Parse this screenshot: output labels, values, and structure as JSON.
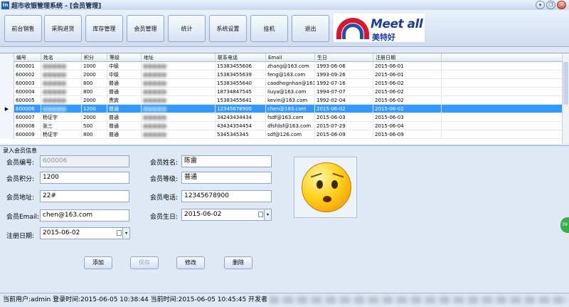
{
  "window": {
    "title": "超市收银管理系统 - [会员管理]",
    "app_icon": "in",
    "buttons": {
      "minimize": "▾",
      "restore": "❐",
      "close": "✕"
    }
  },
  "toolbar": {
    "buttons": [
      "前台销售",
      "采购进货",
      "库存管理",
      "会员管理",
      "统计",
      "系统设置",
      "挂机",
      "退出"
    ]
  },
  "logo": {
    "english": "Meet all",
    "chinese": "美特好"
  },
  "grid": {
    "columns": [
      "编号",
      "姓名",
      "积分",
      "等级",
      "地址",
      "联系电话",
      "Email",
      "生日",
      "注册日期"
    ],
    "rows": [
      [
        "600001",
        "",
        "1000",
        "中级",
        "",
        "15383455606",
        "zhang@163.com",
        "1993-06-06",
        "2015-06-01"
      ],
      [
        "600002",
        "",
        "2000",
        "中级",
        "",
        "15383455639",
        "feng@163.com",
        "1993-09-26",
        "2015-06-01"
      ],
      [
        "600003",
        "",
        "800",
        "普通",
        "",
        "15383455640",
        "caodhognhan@163.com",
        "1992-07-16",
        "2015-06-02"
      ],
      [
        "600004",
        "",
        "800",
        "普通",
        "",
        "18734847545",
        "liuya@163.com",
        "1994-07-07",
        "2015-06-02"
      ],
      [
        "600005",
        "",
        "2000",
        "贵宾",
        "",
        "15383455641",
        "kevin@163.com",
        "1992-02-04",
        "2015-06-02"
      ],
      [
        "600006",
        "",
        "1200",
        "普通",
        "",
        "12345678900",
        "chen@163.com",
        "2015-06-02",
        "2015-06-02"
      ],
      [
        "600007",
        "杨证宇",
        "2000",
        "普通",
        "",
        "34243434434",
        "fsdf@163.com",
        "2015-06-03",
        "2015-06-03"
      ],
      [
        "600008",
        "张三",
        "500",
        "普通",
        "",
        "43434354454",
        "dfsfdsf@163.com",
        "2015-07-29",
        "2015-06-04"
      ],
      [
        "600009",
        "杨证宇",
        "800",
        "普通",
        "",
        "5345345345",
        "sdf@126.com",
        "2015-06-09",
        "2015-06-09"
      ]
    ],
    "selected_row_index": 5,
    "selected_marker": "▶"
  },
  "form": {
    "title": "录入会员信息",
    "labels": {
      "id": "会员编号:",
      "name": "会员姓名:",
      "points": "会员积分:",
      "level": "会员等级:",
      "address": "会员地址:",
      "phone": "会员电话:",
      "email": "会员Email:",
      "birthday": "会员生日:",
      "reg_date": "注册日期:"
    },
    "values": {
      "id": "600006",
      "name": "陈雷",
      "points": "1200",
      "level": "普通",
      "address": "22#",
      "phone": "12345678900",
      "email": "chen@163.com",
      "birthday": "2015-06-02",
      "reg_date": "2015-06-02"
    },
    "dropdown_arrow": "▾",
    "actions": {
      "add": "添加",
      "save": "保存",
      "edit": "修改",
      "delete": "删除"
    }
  },
  "side_float": {
    "label": "39"
  },
  "status": {
    "text": "当前用户:admin 登录时间:2015-06-05 10:38:44 当前时间:2015-06-05 10:45:45 开发者"
  }
}
